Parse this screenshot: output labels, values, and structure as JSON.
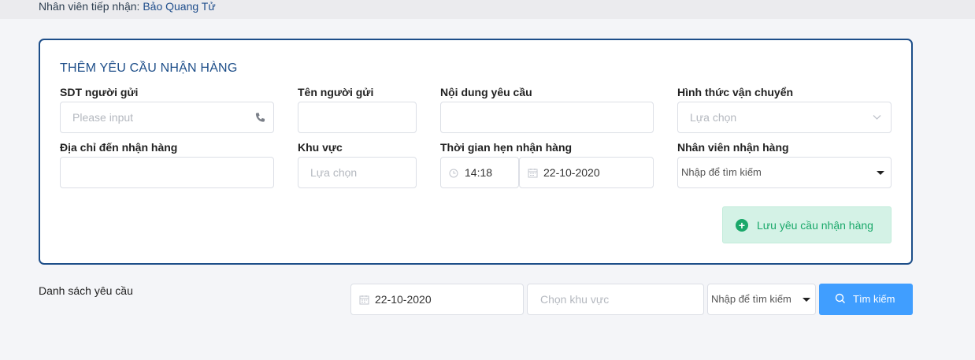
{
  "header": {
    "receiver_label": "Nhân viên tiếp nhận:",
    "receiver_name": "Bảo Quang Tử"
  },
  "form": {
    "title": "THÊM YÊU CẦU NHẬN HÀNG",
    "sender_phone": {
      "label": "SDT người gửi",
      "placeholder": "Please input",
      "icon": "phone-icon"
    },
    "sender_name": {
      "label": "Tên người gửi",
      "value": ""
    },
    "request_content": {
      "label": "Nội dung yêu cầu",
      "value": ""
    },
    "shipping_method": {
      "label": "Hình thức vận chuyển",
      "placeholder": "Lựa chọn",
      "icon": "chevron-down-icon"
    },
    "pickup_address": {
      "label": "Địa chỉ đến nhận hàng",
      "value": ""
    },
    "area": {
      "label": "Khu vực",
      "placeholder": "Lựa chọn"
    },
    "appointment": {
      "label": "Thời gian hẹn nhận hàng",
      "time": "14:18",
      "date": "22-10-2020"
    },
    "pickup_staff": {
      "label": "Nhân viên nhận hàng",
      "placeholder": "Nhập để tìm kiếm"
    },
    "save_button": "Lưu yêu cầu nhận hàng"
  },
  "list": {
    "title": "Danh sách yêu cầu",
    "filter_date": "22-10-2020",
    "filter_area_placeholder": "Chọn khu vực",
    "filter_staff_placeholder": "Nhập để tìm kiếm",
    "search_button": "Tìm kiếm"
  },
  "colors": {
    "accent": "#1d4e89",
    "primary": "#409eff",
    "success": "#1aa86a"
  }
}
